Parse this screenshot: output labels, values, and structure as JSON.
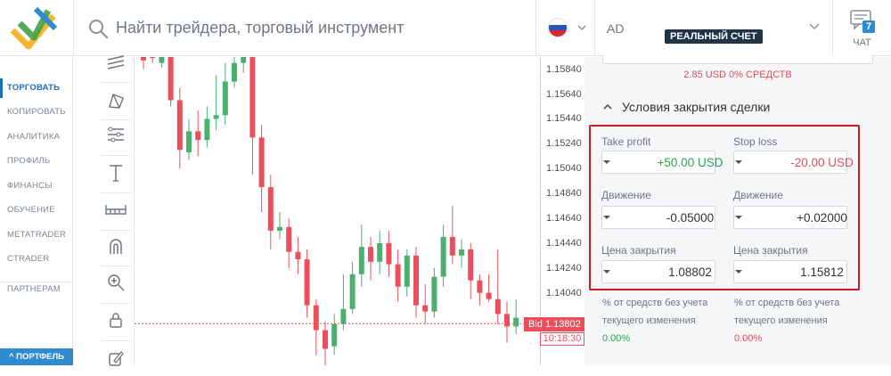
{
  "header": {
    "search_placeholder": "Найти трейдера, торговый инструмент",
    "account": {
      "code": "AD",
      "badge": "РЕАЛЬНЫЙ СЧЕТ"
    },
    "chat": {
      "label": "ЧАТ",
      "badge": "7"
    }
  },
  "nav": {
    "items": [
      "ТОРГОВАТЬ",
      "КОПИРОВАТЬ",
      "АНАЛИТИКА",
      "ПРОФИЛЬ",
      "ФИНАНСЫ",
      "ОБУЧЕНИЕ",
      "METATRADER",
      "CTRADER",
      "ПАРТНЕРАМ"
    ],
    "active": "ТОРГОВАТЬ",
    "portfolio": "^ ПОРТФЕЛЬ"
  },
  "tools": [
    "lines-icon",
    "polygon-icon",
    "fibonacci-icon",
    "text-icon",
    "ruler-icon",
    "magnet-icon",
    "zoom-icon",
    "lock-icon",
    "edit-icon"
  ],
  "chart": {
    "price_ticks": [
      "1.15840",
      "1.15640",
      "1.15440",
      "1.15240",
      "1.15040",
      "1.14840",
      "1.14640",
      "1.14440",
      "1.14240",
      "1.14040"
    ],
    "bid_label": "Bid 1.13802",
    "bid_price": 1.13802,
    "timer": "10:18:30",
    "colors": {
      "up": "#4caf6e",
      "down": "#e9505c",
      "bid": "#e9505c"
    }
  },
  "panel": {
    "margin_text": "2.85 USD   0% СРЕДСТВ",
    "section_title": "Условия закрытия сделки",
    "take_profit": {
      "label": "Take profit",
      "value": "+50.00 USD",
      "move_label": "Движение",
      "move_value": "-0.05000",
      "close_label": "Цена закрытия",
      "close_value": "1.08802",
      "note": "% от средств без учета текущего изменения",
      "pct": "0.00%"
    },
    "stop_loss": {
      "label": "Stop loss",
      "value": "-20.00 USD",
      "move_label": "Движение",
      "move_value": "+0.02000",
      "close_label": "Цена закрытия",
      "close_value": "1.15812",
      "note": "% от средств без учета текущего изменения",
      "pct": "0.00%"
    }
  }
}
